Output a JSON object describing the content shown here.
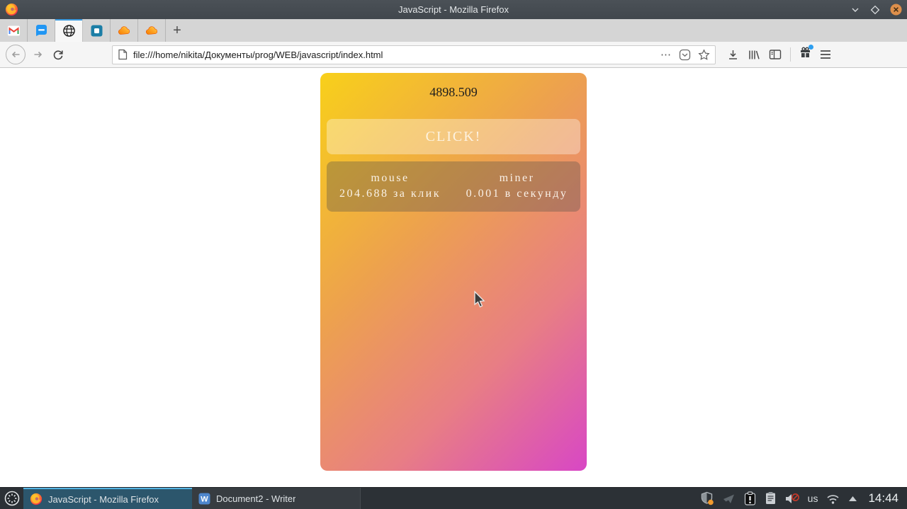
{
  "window": {
    "title": "JavaScript - Mozilla Firefox",
    "controls": [
      "minimize",
      "maximize",
      "close"
    ]
  },
  "tabs": {
    "items": [
      {
        "icon": "gmail-icon"
      },
      {
        "icon": "messages-icon"
      },
      {
        "icon": "globe-icon",
        "active": true
      },
      {
        "icon": "blue-app-icon"
      },
      {
        "icon": "cloud-icon"
      },
      {
        "icon": "cloud-icon"
      }
    ],
    "new_tab_label": "+"
  },
  "toolbar": {
    "url": "file:///home/nikita/Документы/prog/WEB/javascript/index.html",
    "page_actions_label": "⋯",
    "icons": [
      "back-icon",
      "forward-icon",
      "reload-icon",
      "page-icon",
      "pocket-icon",
      "bookmark-star-icon",
      "download-icon",
      "library-icon",
      "sidebar-icon",
      "whats-new-gift-icon",
      "menu-icon"
    ]
  },
  "page": {
    "score": "4898.509",
    "click_button": "CLICK!",
    "upgrades": [
      {
        "name": "mouse",
        "rate": "204.688 за клик"
      },
      {
        "name": "miner",
        "rate": "0.001 в секунду"
      }
    ]
  },
  "taskbar": {
    "tasks": [
      {
        "label": "JavaScript - Mozilla Firefox",
        "active": true
      },
      {
        "label": "Document2 - Writer",
        "active": false
      }
    ],
    "tray_icons": [
      "shield-badge-icon",
      "send-plane-icon",
      "clipboard-warning-icon",
      "clipboard-icon",
      "volume-muted-icon",
      "keyboard-layout",
      "wifi-icon",
      "caret-up-icon"
    ],
    "keyboard_layout": "us",
    "clock": "14:44"
  },
  "colors": {
    "card_gradient_start": "#f8d01a",
    "card_gradient_mid": "#eda24d",
    "card_gradient_end": "#d847c5",
    "active_tab_line": "#3c9be0",
    "taskbar_active": "#2c566c",
    "accent_blue": "#3daee9",
    "notification_dot": "#2e9ff0",
    "tray_badge_orange": "#f29b2e"
  }
}
